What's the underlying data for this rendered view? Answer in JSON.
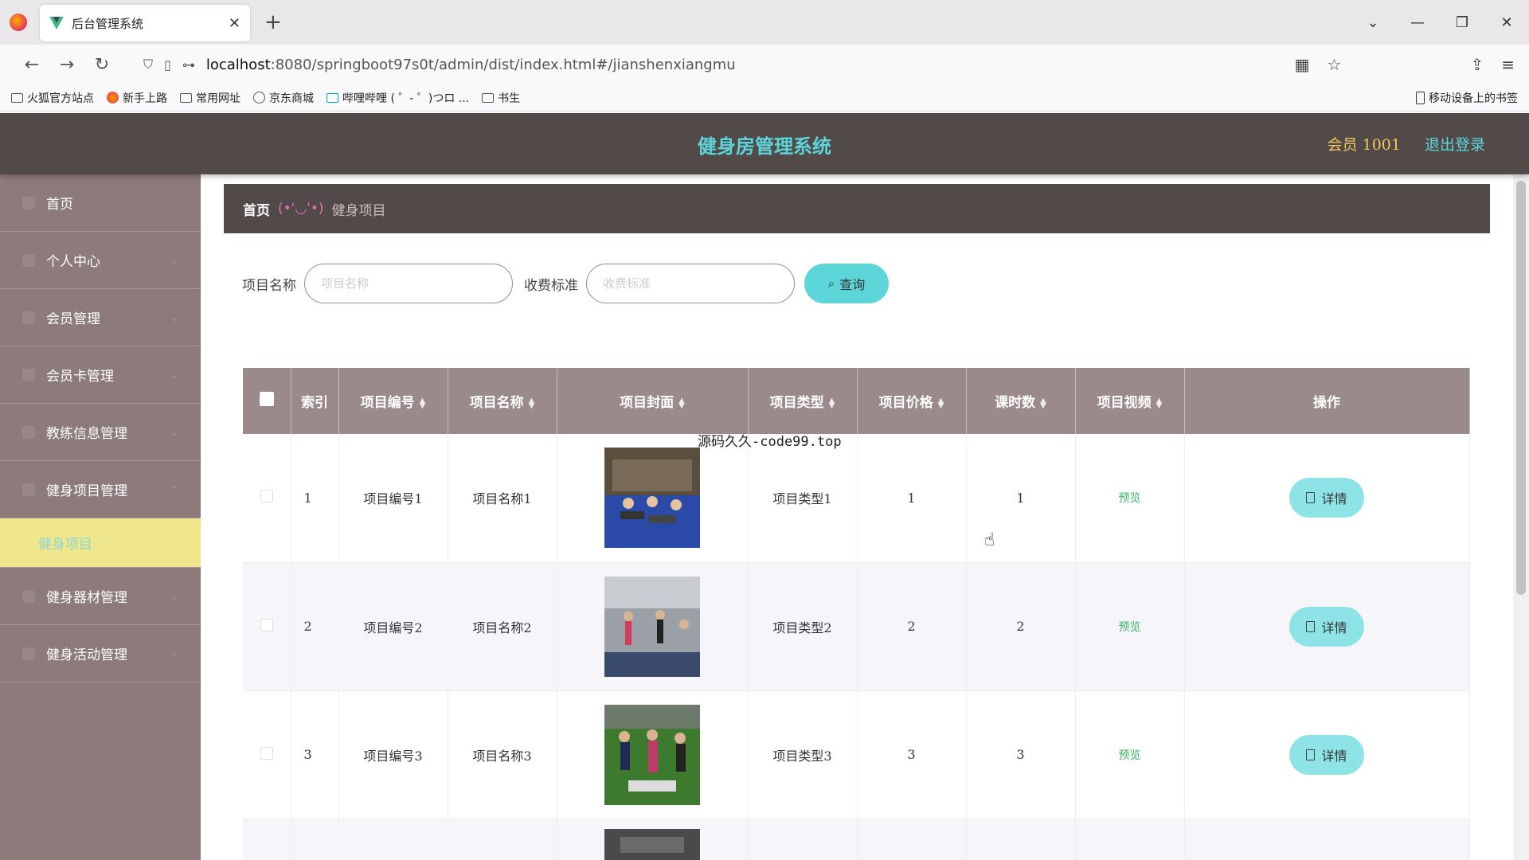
{
  "browser": {
    "tab_title": "后台管理系统",
    "tab_close": "✕",
    "new_tab": "+",
    "url_host": "localhost",
    "url_path": ":8080/springboot97s0t/admin/dist/index.html#/jianshenxiangmu",
    "bookmarks": [
      "火狐官方站点",
      "新手上路",
      "常用网址",
      "京东商城",
      "哔哩哔哩 ( ゜- ゜)つロ ...",
      "书生"
    ],
    "mobile_bookmarks": "移动设备上的书签"
  },
  "header": {
    "title": "健身房管理系统",
    "member": "会员 1001",
    "logout": "退出登录"
  },
  "sidebar": {
    "items": [
      {
        "label": "首页"
      },
      {
        "label": "个人中心"
      },
      {
        "label": "会员管理"
      },
      {
        "label": "会员卡管理"
      },
      {
        "label": "教练信息管理"
      },
      {
        "label": "健身项目管理"
      },
      {
        "label": "健身项目"
      },
      {
        "label": "健身器材管理"
      },
      {
        "label": "健身活动管理"
      }
    ]
  },
  "breadcrumb": {
    "home": "首页",
    "separator": "(•'◡'•)",
    "current": "健身项目"
  },
  "search": {
    "name_label": "项目名称",
    "name_placeholder": "项目名称",
    "fee_label": "收费标准",
    "fee_placeholder": "收费标准",
    "button": "查询"
  },
  "table": {
    "headers": [
      "索引",
      "项目编号",
      "项目名称",
      "项目封面",
      "项目类型",
      "项目价格",
      "课时数",
      "项目视频",
      "操作"
    ],
    "rows": [
      {
        "index": "1",
        "code": "项目编号1",
        "name": "项目名称1",
        "type": "项目类型1",
        "price": "1",
        "hours": "1",
        "video": "预览",
        "action": "详情"
      },
      {
        "index": "2",
        "code": "项目编号2",
        "name": "项目名称2",
        "type": "项目类型2",
        "price": "2",
        "hours": "2",
        "video": "预览",
        "action": "详情"
      },
      {
        "index": "3",
        "code": "项目编号3",
        "name": "项目名称3",
        "type": "项目类型3",
        "price": "3",
        "hours": "3",
        "video": "预览",
        "action": "详情"
      }
    ]
  },
  "overlay_text": "源码久久-code99.top",
  "colors": {
    "header_bg": "#524949",
    "sidebar_bg": "#8d7b7b",
    "accent": "#5cd6d9",
    "active_menu": "#f0e68c",
    "table_head": "#9b8a8a"
  }
}
